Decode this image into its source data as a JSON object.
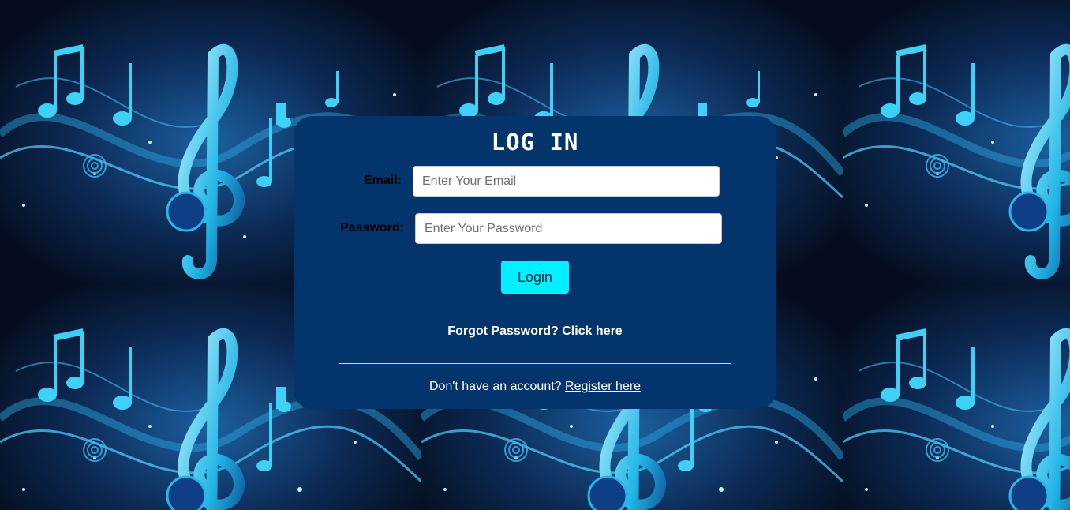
{
  "login": {
    "title": "LOG IN",
    "email_label": "Email:",
    "email_placeholder": "Enter Your Email",
    "email_value": "",
    "password_label": "Password:",
    "password_placeholder": "Enter Your Password",
    "password_value": "",
    "login_button": "Login",
    "forgot_text": "Forgot Password?",
    "forgot_link": "Click here",
    "register_text": "Don't have an account?",
    "register_link": "Register here"
  },
  "background": {
    "image": "music-notes-treble-clef-icon",
    "colors": {
      "dark": "#07142b",
      "glow": "#1ec8f0",
      "mid": "#0f4c8a"
    }
  },
  "colors": {
    "card": "#03346b",
    "button": "#00f0ff",
    "text": "#ffffff"
  }
}
